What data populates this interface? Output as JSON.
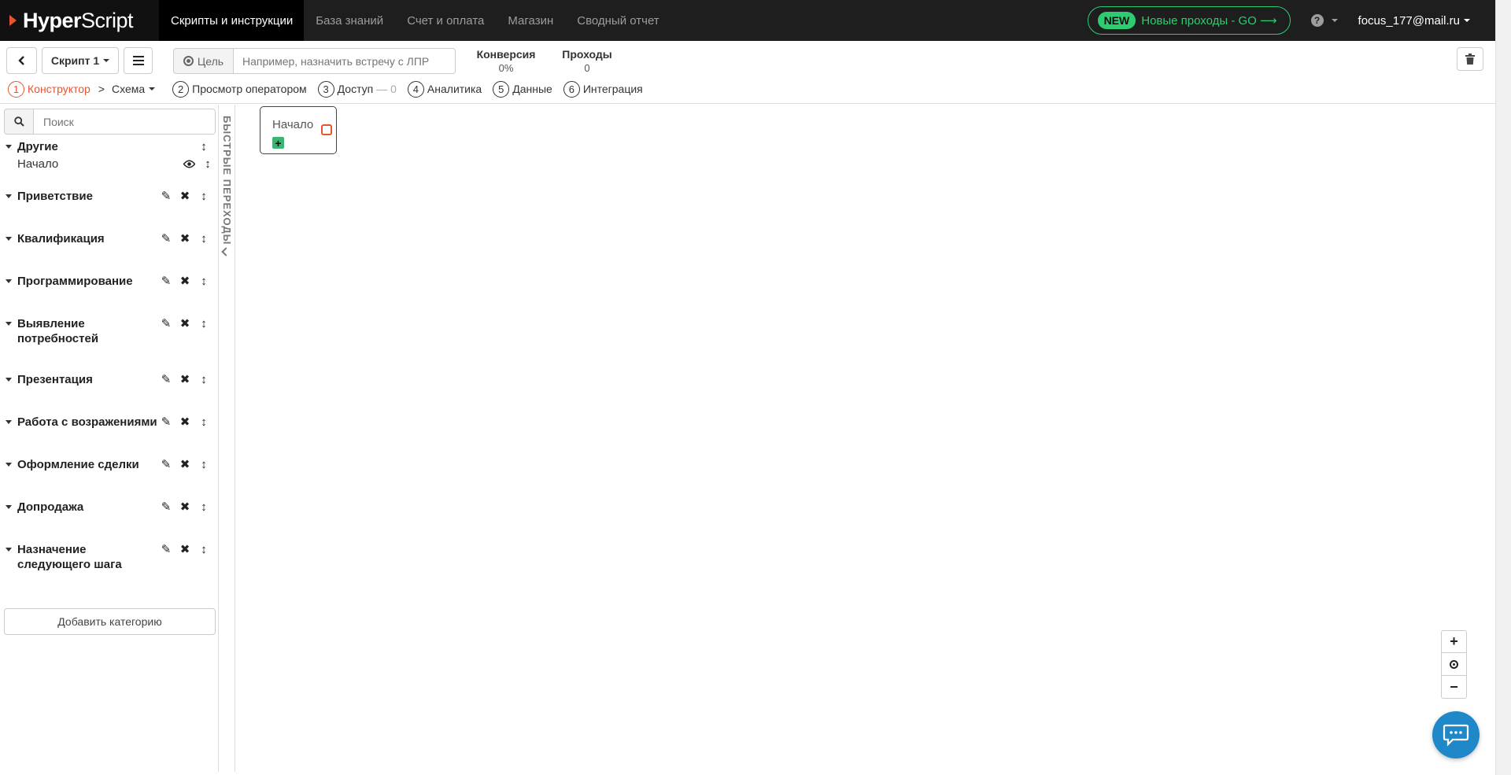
{
  "brand": {
    "bold": "Hyper",
    "light": "Script"
  },
  "nav": [
    {
      "label": "Скрипты и инструкции",
      "active": true
    },
    {
      "label": "База знаний"
    },
    {
      "label": "Счет и оплата"
    },
    {
      "label": "Магазин"
    },
    {
      "label": "Сводный отчет"
    }
  ],
  "promo": {
    "badge": "NEW",
    "text": "Новые проходы - GO ⟶"
  },
  "user": {
    "email": "focus_177@mail.ru"
  },
  "toolbar": {
    "script_label": "Скрипт 1",
    "goal_label": "Цель",
    "goal_placeholder": "Например, назначить встречу с ЛПР",
    "conversion_label": "Конверсия",
    "conversion_value": "0%",
    "passes_label": "Проходы",
    "passes_value": "0"
  },
  "steps": [
    {
      "num": "1",
      "label": "Конструктор"
    },
    {
      "num": "2",
      "label": "Просмотр оператором"
    },
    {
      "num": "3",
      "label": "Доступ",
      "extra": "— 0"
    },
    {
      "num": "4",
      "label": "Аналитика"
    },
    {
      "num": "5",
      "label": "Данные"
    },
    {
      "num": "6",
      "label": "Интеграция"
    }
  ],
  "breadcrumb": {
    "separator": ">",
    "schema": "Схема"
  },
  "sidebar": {
    "search_placeholder": "Поиск",
    "categories": [
      {
        "title": "Другие",
        "sub": "Начало"
      },
      {
        "title": "Приветствие"
      },
      {
        "title": "Квалификация"
      },
      {
        "title": "Программирование"
      },
      {
        "title": "Выявление потребностей"
      },
      {
        "title": "Презентация"
      },
      {
        "title": "Работа с возражениями"
      },
      {
        "title": "Оформление сделки"
      },
      {
        "title": "Допродажа"
      },
      {
        "title": "Назначение следующего шага"
      }
    ],
    "add_category": "Добавить категорию"
  },
  "quick_transitions": "БЫСТРЫЕ ПЕРЕХОДЫ",
  "canvas": {
    "node_title": "Начало",
    "add_symbol": "+"
  },
  "zoom": {
    "plus": "+",
    "minus": "−"
  },
  "colors": {
    "accent": "#e8542f",
    "promo": "#2ecc71",
    "chat": "#1e88c8",
    "navbar": "#1e1e1e"
  }
}
